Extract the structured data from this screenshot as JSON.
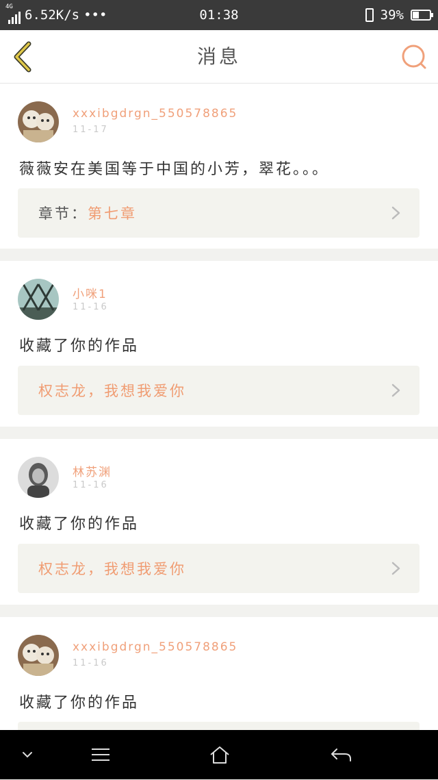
{
  "status_bar": {
    "network_type": "4G",
    "speed": "6.52K/s",
    "dots": "•••",
    "time": "01:38",
    "battery_percent": "39%",
    "battery_level": 0.39
  },
  "header": {
    "title": "消息",
    "accent_color": "#f0a07a"
  },
  "messages": [
    {
      "username": "xxxibgdrgn_550578865",
      "date": "11-17",
      "content": "薇薇安在美国等于中国的小芳，翠花。。。",
      "link_prefix": "章节：",
      "link_text": "第七章"
    },
    {
      "username": "小咪1",
      "date": "11-16",
      "content": "收藏了你的作品",
      "link_prefix": "",
      "link_text": "权志龙，我想我爱你"
    },
    {
      "username": "林苏渊",
      "date": "11-16",
      "content": "收藏了你的作品",
      "link_prefix": "",
      "link_text": "权志龙，我想我爱你"
    },
    {
      "username": "xxxibgdrgn_550578865",
      "date": "11-16",
      "content": "收藏了你的作品",
      "link_prefix": "",
      "link_text": ""
    }
  ],
  "icons": {
    "back": "chevron-left-icon",
    "search": "search-icon",
    "nav_down": "chevron-down-icon",
    "nav_menu": "menu-icon",
    "nav_home": "home-icon",
    "nav_back": "return-icon"
  }
}
